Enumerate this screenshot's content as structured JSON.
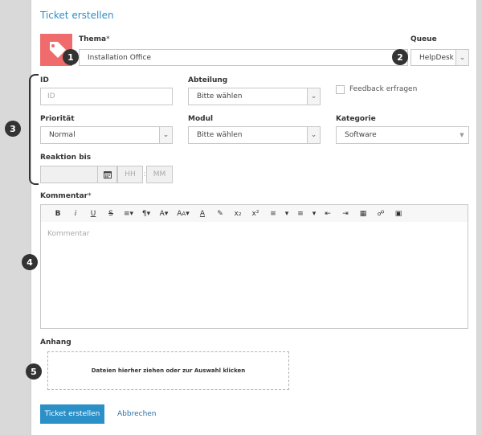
{
  "form": {
    "title": "Ticket erstellen",
    "thema_label": "Thema",
    "thema_value": "Installation Office",
    "queue_label": "Queue",
    "queue_value": "HelpDesk 1",
    "id_label": "ID",
    "id_placeholder": "ID",
    "abteilung_label": "Abteilung",
    "abteilung_value": "Bitte wählen",
    "feedback_label": "Feedback erfragen",
    "prioritaet_label": "Priorität",
    "prioritaet_value": "Normal",
    "modul_label": "Modul",
    "modul_value": "Bitte wählen",
    "kategorie_label": "Kategorie",
    "kategorie_value": "Software",
    "reaktion_label": "Reaktion bis",
    "hh_placeholder": "HH",
    "mm_placeholder": "MM",
    "kommentar_label": "Kommentar",
    "kommentar_placeholder": "Kommentar",
    "anhang_label": "Anhang",
    "drop_text": "Dateien hierher ziehen oder zur Auswahl klicken",
    "submit_label": "Ticket erstellen",
    "cancel_label": "Abbrechen",
    "required_mark": "*"
  },
  "toolbar": {
    "bold": "B",
    "italic": "i",
    "underline": "U",
    "strike": "S",
    "subscript": "x₂",
    "superscript": "x²"
  },
  "callouts": [
    "1",
    "2",
    "3",
    "4",
    "5"
  ],
  "colors": {
    "accent": "#2b90c8",
    "tag_tile": "#f06b6b",
    "badge": "#333333"
  }
}
